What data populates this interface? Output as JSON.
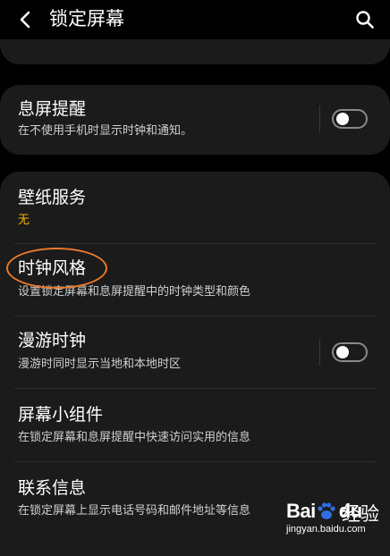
{
  "header": {
    "title": "锁定屏幕",
    "back_icon": "chevron-left-icon",
    "search_icon": "search-icon"
  },
  "always_on_display": {
    "title": "息屏提醒",
    "subtitle": "在不使用手机时显示时钟和通知。",
    "toggle_on": false
  },
  "wallpaper_services": {
    "title": "壁纸服务",
    "value": "无",
    "value_color": "#f2b500"
  },
  "clock_style": {
    "title": "时钟风格",
    "subtitle": "设置锁定屏幕和息屏提醒中的时钟类型和颜色",
    "highlight_color": "#e87a2b"
  },
  "roaming_clock": {
    "title": "漫游时钟",
    "subtitle": "漫游时同时显示当地和本地时区",
    "toggle_on": false
  },
  "widgets": {
    "title": "屏幕小组件",
    "subtitle": "在锁定屏幕和息屏提醒中快速访问实用的信息"
  },
  "contact_info": {
    "title": "联系信息",
    "subtitle": "在锁定屏幕上显示电话号码和邮件地址等信息"
  },
  "watermark": {
    "logo": "Bai",
    "logo_suffix": "du",
    "brand": "经验",
    "url": "jingyan.baidu.com"
  }
}
